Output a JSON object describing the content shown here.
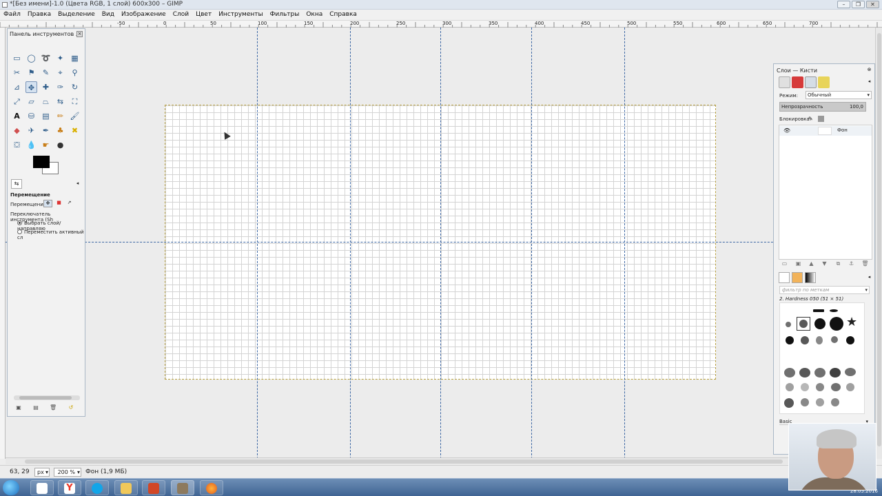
{
  "window": {
    "title": "*[Без имени]-1.0 (Цвета RGB, 1 слой) 600x300 – GIMP",
    "btn_min": "–",
    "btn_max": "❐",
    "btn_close": "✕"
  },
  "menu": {
    "items": [
      "Файл",
      "Правка",
      "Выделение",
      "Вид",
      "Изображение",
      "Слой",
      "Цвет",
      "Инструменты",
      "Фильтры",
      "Окна",
      "Справка"
    ]
  },
  "ruler": {
    "labels": [
      "-50",
      "0",
      "50",
      "100",
      "150",
      "200",
      "250",
      "300",
      "350",
      "400",
      "450",
      "500",
      "550",
      "600",
      "650",
      "700"
    ]
  },
  "toolbox": {
    "title": "Панель инструментов ...",
    "options_title": "Перемещение",
    "move_label": "Перемещение:",
    "switcher_label": "Переключатель инструмента (Sh",
    "radio1": "Выбрать слой/направляю",
    "radio2": "Переместить активный сл"
  },
  "status": {
    "coords": "63, 29",
    "unit": "px",
    "zoom": "200 %",
    "layer_info": "Фон (1,9 МБ)"
  },
  "layers": {
    "title": "Слои — Кисти",
    "mode_label": "Режим:",
    "mode_value": "Обычный",
    "opacity_label": "Непрозрачность",
    "opacity_value": "100,0",
    "lock_label": "Блокировка:",
    "layer_name": "Фон"
  },
  "brushes": {
    "filter_placeholder": "фильтр по меткам",
    "brush_name": "2. Hardness 050 (51 × 51)",
    "preset": "Basic"
  },
  "taskbar": {
    "date": "28.05.2016"
  },
  "colors": {
    "guide": "#3b66a3",
    "selection_border": "#b8a040",
    "taskbar": "#4a6f9c"
  }
}
